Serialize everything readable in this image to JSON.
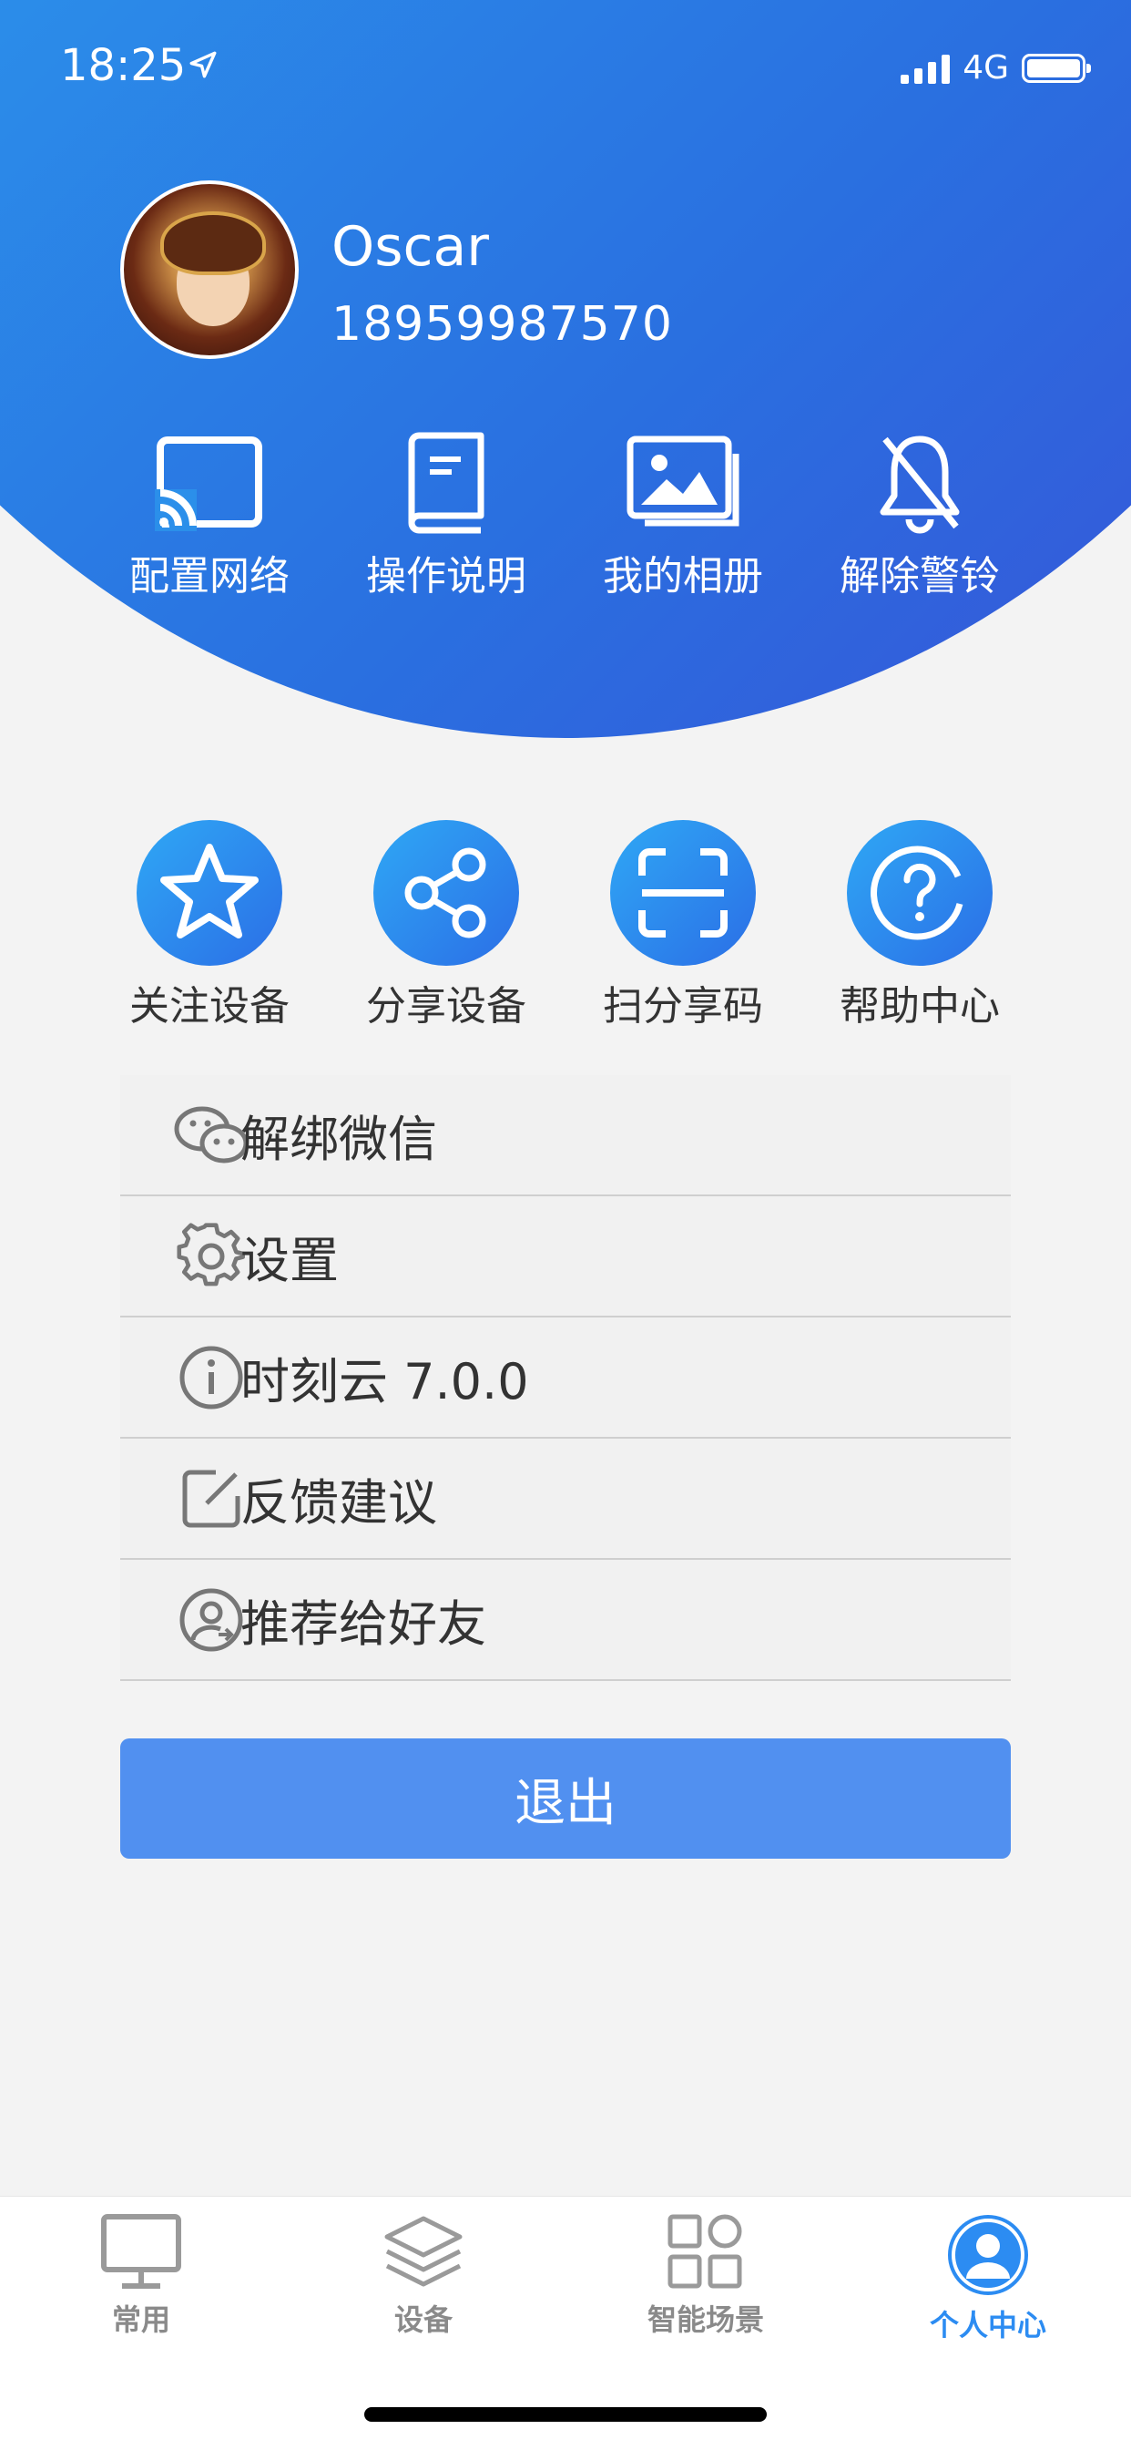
{
  "status": {
    "time": "18:25",
    "network": "4G"
  },
  "profile": {
    "name": "Oscar",
    "phone": "18959987570"
  },
  "top_actions": [
    {
      "label": "配置网络",
      "icon": "cast-icon"
    },
    {
      "label": "操作说明",
      "icon": "book-icon"
    },
    {
      "label": "我的相册",
      "icon": "album-icon"
    },
    {
      "label": "解除警铃",
      "icon": "bell-off-icon"
    }
  ],
  "circle_actions": [
    {
      "label": "关注设备",
      "icon": "star-icon"
    },
    {
      "label": "分享设备",
      "icon": "share-icon"
    },
    {
      "label": "扫分享码",
      "icon": "scan-icon"
    },
    {
      "label": "帮助中心",
      "icon": "help-icon"
    }
  ],
  "menu": [
    {
      "label": "解绑微信",
      "icon": "wechat-icon"
    },
    {
      "label": "设置",
      "icon": "gear-icon"
    },
    {
      "label": "时刻云 7.0.0",
      "icon": "info-icon"
    },
    {
      "label": "反馈建议",
      "icon": "edit-icon"
    },
    {
      "label": "推荐给好友",
      "icon": "user-share-icon"
    }
  ],
  "logout_label": "退出",
  "tabs": [
    {
      "label": "常用",
      "icon": "monitor-icon",
      "active": false
    },
    {
      "label": "设备",
      "icon": "layers-icon",
      "active": false
    },
    {
      "label": "智能场景",
      "icon": "grid-icon",
      "active": false
    },
    {
      "label": "个人中心",
      "icon": "person-icon",
      "active": true
    }
  ],
  "colors": {
    "accent": "#2c8cf2",
    "logout": "#5190f0",
    "gradient_start": "#19b6f6",
    "gradient_end": "#3a4fd6"
  }
}
